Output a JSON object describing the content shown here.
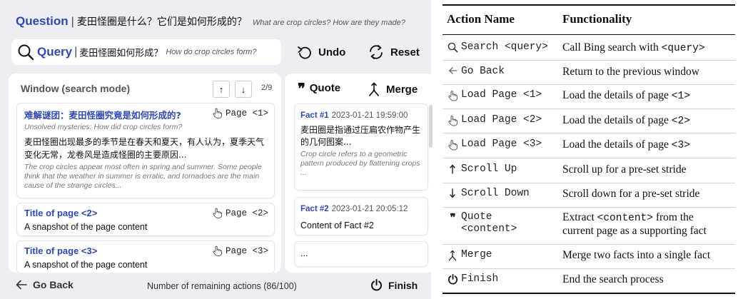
{
  "question": {
    "keyword": "Question",
    "zh": "麦田怪圈是什么？它们是如何形成的？",
    "en": "What are crop circles? How are they made?"
  },
  "query": {
    "keyword": "Query",
    "zh": "麦田怪圈如何形成？",
    "en": "How do crop circles form?"
  },
  "controls": {
    "undo": "Undo",
    "reset": "Reset"
  },
  "window": {
    "title": "Window (search mode)",
    "scroll_up": "↑",
    "scroll_down": "↓",
    "page_counter": "2/9",
    "results": [
      {
        "title": "难解谜团：麦田怪圈究竟是如何形成的?",
        "subtitle": "Unsolved mysteries: How did crop circles form?",
        "zh_snippet": "麦田怪圈出现最多的季节是在春天和夏天，有人认为，夏季天气变化无常，龙卷风是造成怪圈的主要原因...",
        "en_snippet": "The crop circles appear most often in spring and summer. Some people think that the weather in summer is erratic, and tornadoes are the main cause of the strange circles...",
        "action": "Page <1>"
      },
      {
        "title": "Title of page <2>",
        "snippet": "A snapshot of the page content",
        "action": "Page <2>"
      },
      {
        "title": "Title of page <3>",
        "snippet": "A snapshot of the page content",
        "action": "Page <3>"
      }
    ]
  },
  "facts": {
    "quote_label": "Quote",
    "merge_label": "Merge",
    "items": [
      {
        "label": "Fact #1",
        "time": "2023-01-21 19:59:00",
        "zh": "麦田圈是指通过压扁农作物产生的几何图案...",
        "en": "Crop circle refers to a geometric pattern produced by flattening crops ..."
      },
      {
        "label": "Fact #2",
        "time": "2023-01-21 20:05:12",
        "content": "Content of Fact #2"
      }
    ],
    "more": "..."
  },
  "footer": {
    "go_back": "Go Back",
    "remaining": "Number of remaining actions (86/100)",
    "finish": "Finish"
  },
  "table": {
    "headers": {
      "name": "Action Name",
      "func": "Functionality"
    },
    "rows": [
      {
        "icon": "search-icon",
        "name": [
          "Search <query>"
        ],
        "func": [
          "Call Bing search with ",
          "<query>",
          ""
        ]
      },
      {
        "icon": "arrow-left-icon",
        "name": [
          "Go Back"
        ],
        "func": [
          "Return to the previous window"
        ]
      },
      {
        "icon": "hand-pointer-icon",
        "name": [
          "Load Page <1>"
        ],
        "func": [
          "Load the details of  page ",
          "<1>",
          ""
        ]
      },
      {
        "icon": "hand-pointer-icon",
        "name": [
          "Load Page <2>"
        ],
        "func": [
          "Load the details of  page ",
          "<2>",
          ""
        ]
      },
      {
        "icon": "hand-pointer-icon",
        "name": [
          "Load Page <3>"
        ],
        "func": [
          "Load the details of  page ",
          "<3>",
          ""
        ]
      },
      {
        "icon": "arrow-up-icon",
        "name": [
          "Scroll Up"
        ],
        "func": [
          "Scroll up for a pre-set stride"
        ]
      },
      {
        "icon": "arrow-down-icon",
        "name": [
          "Scroll Down"
        ],
        "func": [
          "Scroll down for a pre-set stride"
        ]
      },
      {
        "icon": "quote-icon",
        "name": [
          "Quote",
          "<content>"
        ],
        "func": [
          "Extract ",
          "<content>",
          " from the",
          "current page as a supporting fact"
        ]
      },
      {
        "icon": "merge-icon",
        "name": [
          "Merge"
        ],
        "func": [
          "Merge two facts into a single fact"
        ]
      },
      {
        "icon": "power-icon",
        "name": [
          "Finish"
        ],
        "func": [
          "End the search process"
        ]
      }
    ]
  }
}
